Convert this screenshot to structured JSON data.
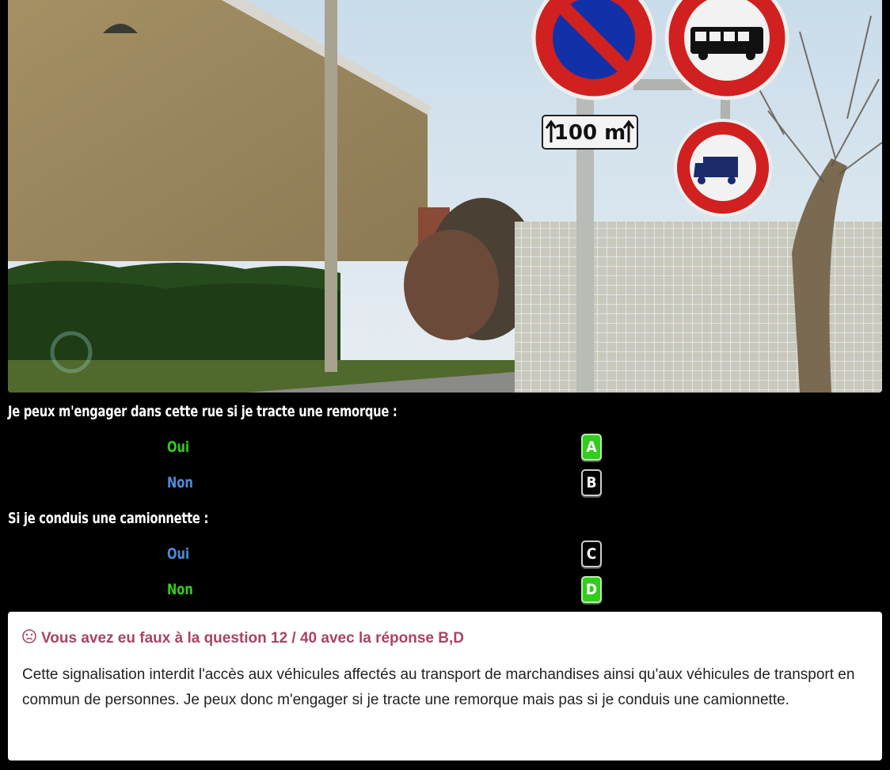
{
  "photo": {
    "description_icons": [
      "no-parking-sign",
      "no-bus-sign",
      "distance-panel",
      "no-goods-vehicle-sign"
    ],
    "distance_label": "100 m"
  },
  "questions": [
    {
      "text": "Je peux m'engager dans cette rue si je tracte une remorque :",
      "options": [
        {
          "label": "Oui",
          "key": "A",
          "correct": true
        },
        {
          "label": "Non",
          "key": "B",
          "correct": false
        }
      ]
    },
    {
      "text": "Si je conduis une camionnette :",
      "options": [
        {
          "label": "Oui",
          "key": "C",
          "correct": false
        },
        {
          "label": "Non",
          "key": "D",
          "correct": true
        }
      ]
    }
  ],
  "result": {
    "icon": "sad-face-icon",
    "title": "Vous avez eu faux à la question 12 / 40 avec la réponse B,D",
    "explanation": "Cette signalisation interdit l'accès aux véhicules affectés au transport de marchandises ainsi qu'aux véhicules de transport en commun de personnes. Je peux donc m'engager si je tracte une remorque mais pas si je conduis une camionnette."
  },
  "colors": {
    "correct": "#33cc1e",
    "incorrect": "#4c8dda",
    "error_title": "#a84561"
  }
}
